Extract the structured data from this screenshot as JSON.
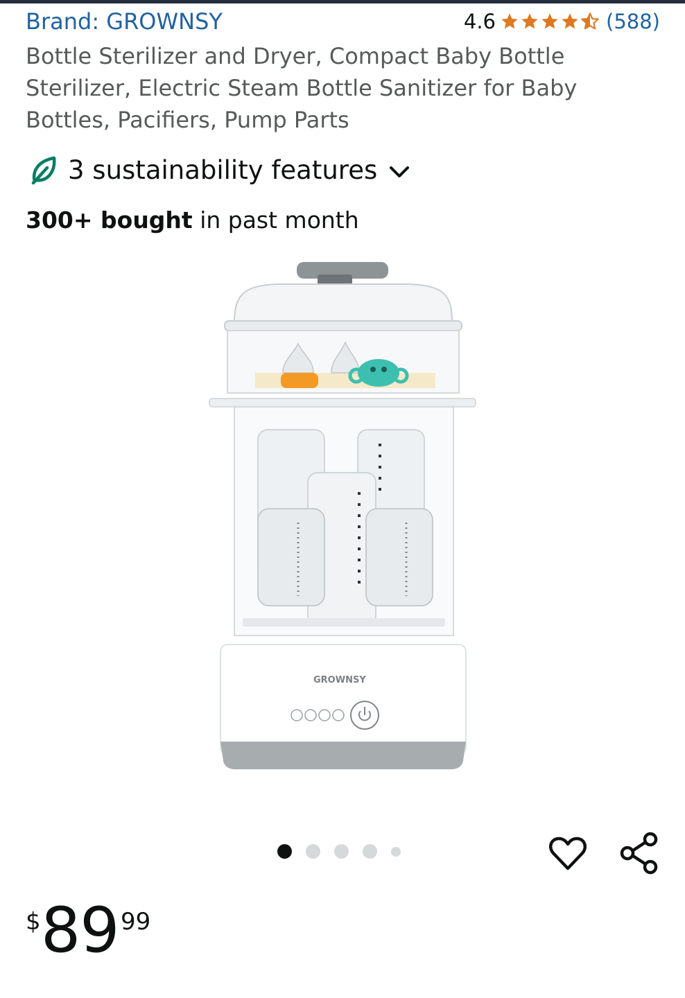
{
  "product": {
    "brand_label": "Brand: GROWNSY",
    "rating_value": "4.6",
    "rating_stars": 4.6,
    "rating_count": "(588)",
    "title": "Bottle Sterilizer and Dryer, Compact Baby Bottle Sterilizer, Electric Steam Bottle Sanitizer for Baby Bottles, Pacifiers, Pump Parts",
    "image_logo_text": "GROWNSY"
  },
  "sustainability": {
    "label": "3 sustainability features",
    "icon": "leaf-icon",
    "toggle_icon": "chevron-down-icon"
  },
  "social_proof": {
    "bold": "300+ bought",
    "rest": " in past month"
  },
  "gallery": {
    "total_images": 5,
    "active_index": 0
  },
  "actions": {
    "wishlist_icon": "heart-icon",
    "share_icon": "share-icon"
  },
  "price": {
    "symbol": "$",
    "whole": "89",
    "fraction": "99"
  },
  "colors": {
    "link": "#2162a1",
    "star": "#de7921",
    "leaf": "#067d62",
    "text": "#0f1111",
    "muted": "#565959"
  }
}
